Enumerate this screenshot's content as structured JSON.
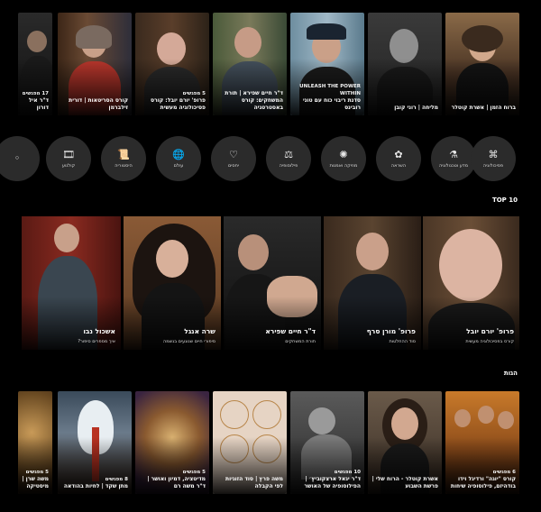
{
  "top_row": [
    {
      "meta": "17 מפגשים",
      "title": "ד\"ר איל דורון"
    },
    {
      "meta": "",
      "title": "קורס הסריטאות | דורית זילברמן"
    },
    {
      "meta": "5 מפגשים",
      "title": "פרופ' יורם יובל: קורס פסיכולוגיה מעשית"
    },
    {
      "meta": "",
      "title": "ד\"ר חיים שפירא | תורת המשחקים: קורס באסטרטגיה"
    },
    {
      "meta": "UNLEASH THE POWER WITHIN",
      "title": "סדנת ריבוי כוח עם טוני רובינס"
    },
    {
      "meta": "",
      "title": "מליחה | רוני קובן"
    },
    {
      "meta": "",
      "title": "ברוח הזמן | אשרת קוטלר"
    }
  ],
  "categories": [
    {
      "label": "",
      "icon": "partial"
    },
    {
      "label": "קולנוע",
      "icon": "film-icon"
    },
    {
      "label": "היסטוריה",
      "icon": "scroll-icon"
    },
    {
      "label": "עולם",
      "icon": "globe-icon"
    },
    {
      "label": "יחסים",
      "icon": "heart-icon"
    },
    {
      "label": "פילוסופיה",
      "icon": "scales-icon"
    },
    {
      "label": "מוזיקה ואמנות",
      "icon": "music-icon"
    },
    {
      "label": "השראה",
      "icon": "sparkle-icon"
    },
    {
      "label": "מדע וטכנולוגיה",
      "icon": "flask-icon"
    },
    {
      "label": "פסיכולוגיה",
      "icon": "mind-icon"
    }
  ],
  "top10": {
    "title": "TOP 10",
    "items": [
      {
        "name": "פרופ' יורם יובל",
        "sub": "קורס בפסיכולוגיה מעשית"
      },
      {
        "name": "פרופ' מורן סרף",
        "sub": "סוד ההחלטות"
      },
      {
        "name": "ד\"ר חיים שפירא",
        "sub": "תורת המשחקים"
      },
      {
        "name": "שרה אנגל",
        "sub": "סיפורי חיים שנוגעים בנשמה"
      },
      {
        "name": "אשכול נבו",
        "sub": "איך מספרים סיפור?"
      }
    ]
  },
  "faith": {
    "title": "הגות",
    "items": [
      {
        "meta": "6 מפגשים",
        "title": "קורס \"יוגה\" ורדיגל וידו בודהיזם, פילוסופיה שיחות"
      },
      {
        "meta": "",
        "title": "אשרת קוטלר - הרוח שלי | פרשת השבוע"
      },
      {
        "meta": "10 מפגשים",
        "title": "ד\"ר יגאל ארצקוביץ׳ | הפילוסופיה של האושר"
      },
      {
        "meta": "",
        "title": "משה פרץ | סוד הזוגיות לפי הקבלה"
      },
      {
        "meta": "5 מפגשים",
        "title": "מדיטציה, דמיון ואושר | ד\"ר משה רם"
      },
      {
        "meta": "8 מפגשים",
        "title": "מתן שקד | לחיות בהודאה"
      },
      {
        "meta": "5 מפגשים",
        "title": "משה שרן | מיסטיקה"
      }
    ]
  }
}
